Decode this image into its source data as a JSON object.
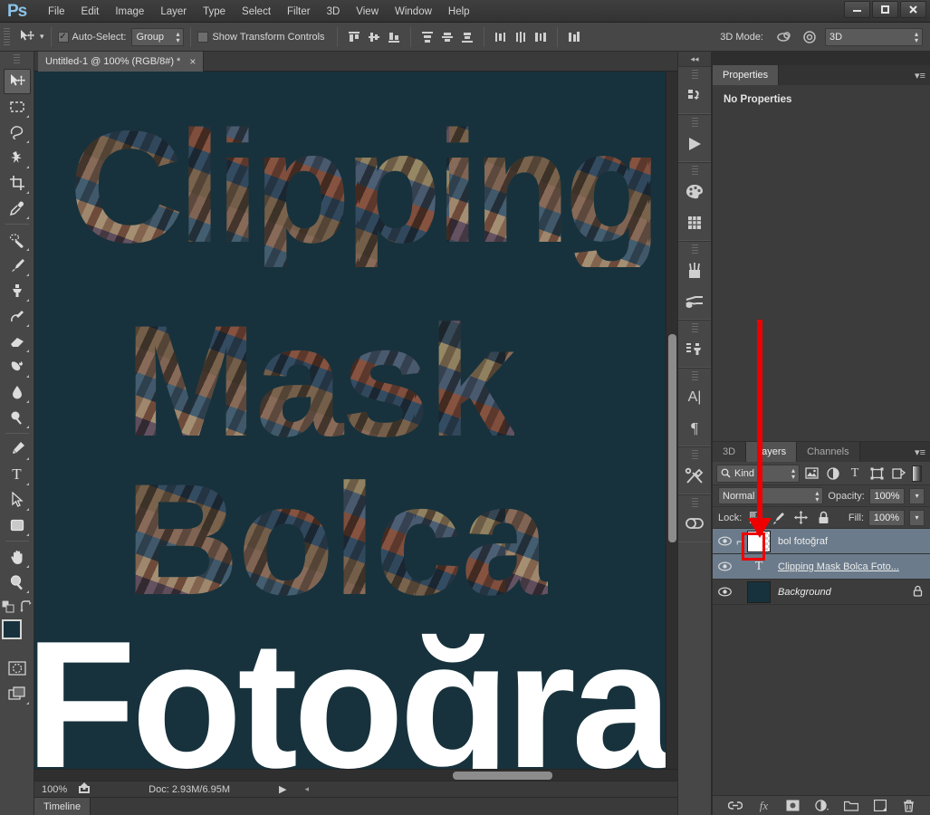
{
  "app": {
    "logo": "Ps",
    "menus": [
      "File",
      "Edit",
      "Image",
      "Layer",
      "Type",
      "Select",
      "Filter",
      "3D",
      "View",
      "Window",
      "Help"
    ],
    "window_controls": [
      {
        "name": "minimize",
        "glyph": "–"
      },
      {
        "name": "maximize",
        "glyph": "❑"
      },
      {
        "name": "close",
        "glyph": "✕"
      }
    ]
  },
  "options_bar": {
    "tool_icon": "move-tool-icon",
    "auto_select_checked": true,
    "auto_select_label": "Auto-Select:",
    "auto_select_value": "Group",
    "show_transform_label": "Show Transform Controls",
    "show_transform_checked": false,
    "align_icons": [
      "align-top-edges-icon",
      "align-vertical-centers-icon",
      "align-bottom-edges-icon",
      "align-left-edges-icon",
      "align-horizontal-centers-icon",
      "align-right-edges-icon"
    ],
    "distribute_icons": [
      "distribute-top-edges-icon",
      "distribute-vertical-centers-icon",
      "distribute-bottom-edges-icon",
      "distribute-left-edges-icon",
      "distribute-horizontal-centers-icon",
      "distribute-right-edges-icon"
    ],
    "auto_align_icon": "auto-align-layers-icon",
    "mode3d_label": "3D Mode:",
    "mode3d_value": "3D"
  },
  "toolbar": {
    "tools": [
      {
        "name": "move-tool",
        "active": true
      },
      {
        "name": "rectangular-marquee-tool",
        "active": false
      },
      {
        "name": "lasso-tool",
        "active": false
      },
      {
        "name": "magic-wand-tool",
        "active": false
      },
      {
        "name": "crop-tool",
        "active": false
      },
      {
        "name": "eyedropper-tool",
        "active": false
      },
      {
        "name": "spot-healing-brush-tool",
        "active": false
      },
      {
        "name": "brush-tool",
        "active": false
      },
      {
        "name": "clone-stamp-tool",
        "active": false
      },
      {
        "name": "history-brush-tool",
        "active": false
      },
      {
        "name": "eraser-tool",
        "active": false
      },
      {
        "name": "gradient-tool",
        "active": false
      },
      {
        "name": "blur-tool",
        "active": false
      },
      {
        "name": "dodge-tool",
        "active": false
      },
      {
        "name": "pen-tool",
        "active": false
      },
      {
        "name": "horizontal-type-tool",
        "active": false
      },
      {
        "name": "path-selection-tool",
        "active": false
      },
      {
        "name": "rectangle-tool",
        "active": false
      },
      {
        "name": "hand-tool",
        "active": false
      },
      {
        "name": "zoom-tool",
        "active": false
      }
    ],
    "foreground_color": "#17323c",
    "background_color": "#000000",
    "default_colors_icon": "default-colors-icon",
    "swap_colors_icon": "swap-colors-icon",
    "quick_mask_icon": "quick-mask-mode-icon",
    "screen_mode_icon": "screen-mode-icon"
  },
  "document": {
    "tab_title": "Untitled-1 @ 100% (RGB/8#) *",
    "close_glyph": "×",
    "zoom_level": "100%",
    "doc_info": "Doc: 2.93M/6.95M",
    "share_icon": "share-icon",
    "play_glyph": "▶",
    "canvas_background": "#17323c",
    "artwork_words": [
      {
        "text": "Clipping",
        "style": "collage"
      },
      {
        "text": "Mask",
        "style": "collage"
      },
      {
        "text": "Bolca",
        "style": "collage"
      },
      {
        "text": "Fotoğraf",
        "style": "solid"
      }
    ]
  },
  "timeline": {
    "tab_label": "Timeline",
    "menu_icon": "panel-menu-icon"
  },
  "icon_dock": {
    "collapse_glyph": "◂◂",
    "groups": [
      [
        "history-panel-icon"
      ],
      [
        "actions-play-icon"
      ],
      [
        "color-panel-icon",
        "swatches-panel-icon"
      ],
      [
        "brush-panel-icon",
        "brush-presets-panel-icon"
      ],
      [
        "clone-source-panel-icon"
      ],
      [
        "character-panel-icon",
        "paragraph-panel-icon"
      ],
      [
        "tool-presets-panel-icon"
      ],
      [
        "creative-cloud-icon"
      ]
    ]
  },
  "properties_panel": {
    "tabs": [
      {
        "label": "Properties",
        "active": true
      }
    ],
    "menu_icon": "panel-menu-icon",
    "empty_message": "No Properties"
  },
  "layers_panel": {
    "tabs": [
      {
        "label": "3D",
        "active": false
      },
      {
        "label": "Layers",
        "active": true
      },
      {
        "label": "Channels",
        "active": false
      }
    ],
    "menu_icon": "panel-menu-icon",
    "filter_kind_label": "Kind",
    "filter_icons": [
      "filter-pixel-layers-icon",
      "filter-adjustment-layers-icon",
      "filter-type-layers-icon",
      "filter-shape-layers-icon",
      "filter-smart-object-layers-icon"
    ],
    "filter_toggle_icon": "filter-enable-toggle",
    "blend_mode": "Normal",
    "opacity_label": "Opacity:",
    "opacity_value": "100%",
    "lock_label": "Lock:",
    "lock_icons": [
      "lock-transparent-pixels-icon",
      "lock-image-pixels-icon",
      "lock-position-icon",
      "lock-all-icon"
    ],
    "fill_label": "Fill:",
    "fill_value": "100%",
    "layers": [
      {
        "name": "bol fotoğraf",
        "visible": true,
        "selected": true,
        "thumb_type": "collage",
        "clipped": true,
        "clip_glyph": "⮣",
        "locked": false,
        "style": "normal"
      },
      {
        "name": "Clipping  Mask  Bolca  Foto...",
        "visible": true,
        "selected": true,
        "thumb_type": "type",
        "thumb_glyph": "T",
        "clipped": false,
        "locked": false,
        "style": "underlined"
      },
      {
        "name": "Background",
        "visible": true,
        "selected": false,
        "thumb_type": "solid",
        "thumb_color": "#17323c",
        "clipped": false,
        "locked": true,
        "lock_glyph": "ὑ2",
        "style": "italic"
      }
    ],
    "footer_icons": [
      "link-layers-icon",
      "add-layer-style-icon",
      "add-layer-mask-icon",
      "new-adjustment-layer-icon",
      "new-group-icon",
      "new-layer-icon",
      "delete-layer-icon"
    ]
  },
  "annotation": {
    "arrow_color": "#ee0000",
    "highlight_color": "#ee0000",
    "arrow_name": "red-annotation-arrow",
    "box_name": "red-annotation-highlight-box"
  }
}
